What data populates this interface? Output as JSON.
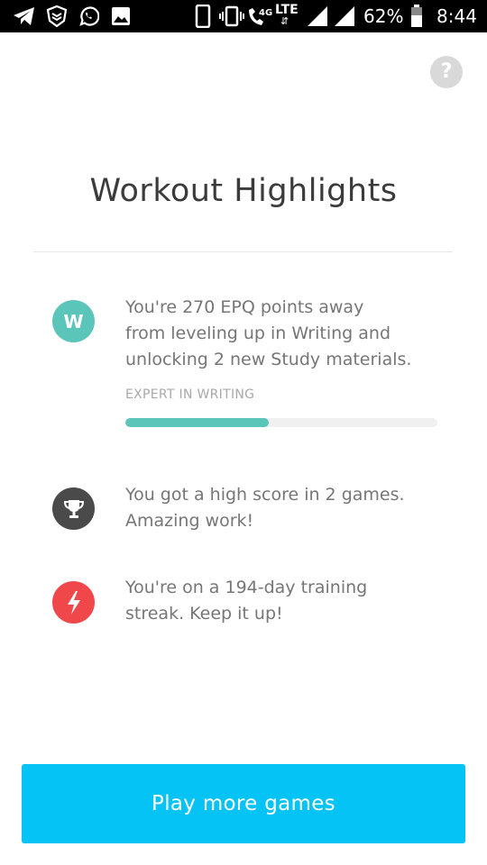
{
  "status_bar": {
    "icons": [
      "telegram-icon",
      "shield-app-icon",
      "whatsapp-icon",
      "image-icon",
      "phone-outline-icon",
      "vibrate-icon",
      "wifi-call-icon",
      "signal-icon",
      "signal-icon",
      "battery-icon"
    ],
    "network_small": "4G",
    "network": "LTE",
    "battery": "62%",
    "time": "8:44"
  },
  "help": {
    "label": "?"
  },
  "title": "Workout Highlights",
  "highlights": [
    {
      "icon": "W",
      "icon_color": "#5cc5ba",
      "lines": [
        "You're 270 EPQ points away",
        "from leveling up in Writing and",
        "unlocking 2 new Study materials."
      ],
      "category": "EXPERT IN WRITING",
      "progress": 0.46
    },
    {
      "icon": "trophy-icon",
      "icon_color": "#4a4a4a",
      "lines": [
        "You got a high score in 2 games.",
        "Amazing work!"
      ]
    },
    {
      "icon": "lightning-icon",
      "icon_color": "#f0474a",
      "lines": [
        "You're on a 194-day training",
        "streak. Keep it up!"
      ]
    }
  ],
  "cta": {
    "label": "Play more games",
    "color": "#05c3f4"
  }
}
